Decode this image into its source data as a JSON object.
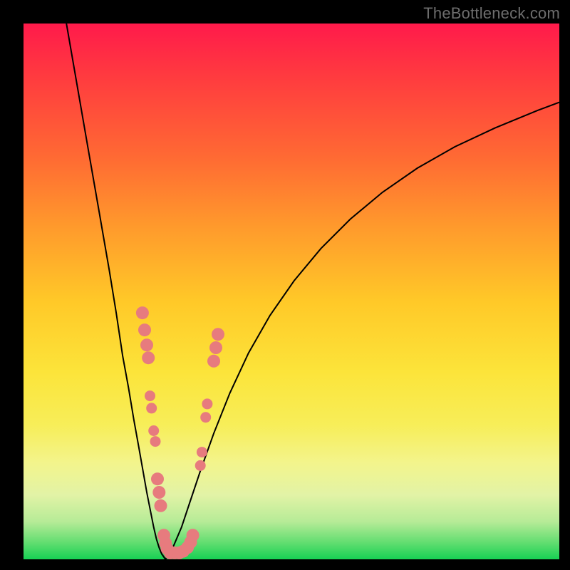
{
  "watermark": "TheBottleneck.com",
  "colors": {
    "frame": "#000000",
    "gradient_top": "#ff1a4b",
    "gradient_bottom": "#17d154",
    "curve": "#000000",
    "dot": "#e77b7e"
  },
  "chart_data": {
    "type": "line",
    "title": "",
    "xlabel": "",
    "ylabel": "",
    "xlim": [
      0,
      100
    ],
    "ylim": [
      0,
      100
    ],
    "series": [
      {
        "name": "left-branch",
        "x": [
          8.0,
          10.0,
          12.0,
          14.0,
          16.0,
          17.3,
          18.5,
          19.6,
          20.6,
          21.5,
          22.3,
          23.0,
          23.7,
          24.3,
          24.8,
          25.3,
          25.8,
          26.5
        ],
        "y": [
          100.0,
          88.5,
          77.0,
          65.5,
          54.0,
          46.0,
          38.0,
          32.0,
          26.0,
          21.0,
          16.5,
          12.5,
          9.0,
          6.0,
          3.8,
          2.2,
          1.0,
          0.0
        ]
      },
      {
        "name": "right-branch",
        "x": [
          26.5,
          28.0,
          29.5,
          31.0,
          33.0,
          35.5,
          38.5,
          42.0,
          46.0,
          50.5,
          55.5,
          61.0,
          67.0,
          73.5,
          80.5,
          88.0,
          96.0,
          100.0
        ],
        "y": [
          0.0,
          2.5,
          6.0,
          10.5,
          16.5,
          23.5,
          31.0,
          38.5,
          45.5,
          52.0,
          58.0,
          63.5,
          68.5,
          73.0,
          77.0,
          80.5,
          83.8,
          85.3
        ]
      }
    ],
    "dots": [
      {
        "x": 22.2,
        "y": 46.0,
        "r": 1.2
      },
      {
        "x": 22.6,
        "y": 42.8,
        "r": 1.2
      },
      {
        "x": 23.0,
        "y": 40.0,
        "r": 1.2
      },
      {
        "x": 23.3,
        "y": 37.6,
        "r": 1.2
      },
      {
        "x": 23.6,
        "y": 30.5,
        "r": 1.0
      },
      {
        "x": 23.9,
        "y": 28.2,
        "r": 1.0
      },
      {
        "x": 24.3,
        "y": 24.0,
        "r": 1.0
      },
      {
        "x": 24.6,
        "y": 22.0,
        "r": 1.0
      },
      {
        "x": 25.0,
        "y": 15.0,
        "r": 1.2
      },
      {
        "x": 25.3,
        "y": 12.5,
        "r": 1.2
      },
      {
        "x": 25.6,
        "y": 10.0,
        "r": 1.2
      },
      {
        "x": 26.2,
        "y": 4.5,
        "r": 1.2
      },
      {
        "x": 26.5,
        "y": 3.0,
        "r": 1.2
      },
      {
        "x": 26.8,
        "y": 2.0,
        "r": 1.2
      },
      {
        "x": 27.4,
        "y": 1.2,
        "r": 1.2
      },
      {
        "x": 28.2,
        "y": 1.2,
        "r": 1.2
      },
      {
        "x": 29.0,
        "y": 1.2,
        "r": 1.2
      },
      {
        "x": 29.8,
        "y": 1.5,
        "r": 1.2
      },
      {
        "x": 30.6,
        "y": 2.2,
        "r": 1.2
      },
      {
        "x": 31.2,
        "y": 3.2,
        "r": 1.2
      },
      {
        "x": 31.6,
        "y": 4.5,
        "r": 1.2
      },
      {
        "x": 33.0,
        "y": 17.5,
        "r": 1.0
      },
      {
        "x": 33.3,
        "y": 20.0,
        "r": 1.0
      },
      {
        "x": 34.0,
        "y": 26.5,
        "r": 1.0
      },
      {
        "x": 34.3,
        "y": 29.0,
        "r": 1.0
      },
      {
        "x": 35.5,
        "y": 37.0,
        "r": 1.2
      },
      {
        "x": 35.9,
        "y": 39.5,
        "r": 1.2
      },
      {
        "x": 36.3,
        "y": 42.0,
        "r": 1.2
      }
    ]
  }
}
